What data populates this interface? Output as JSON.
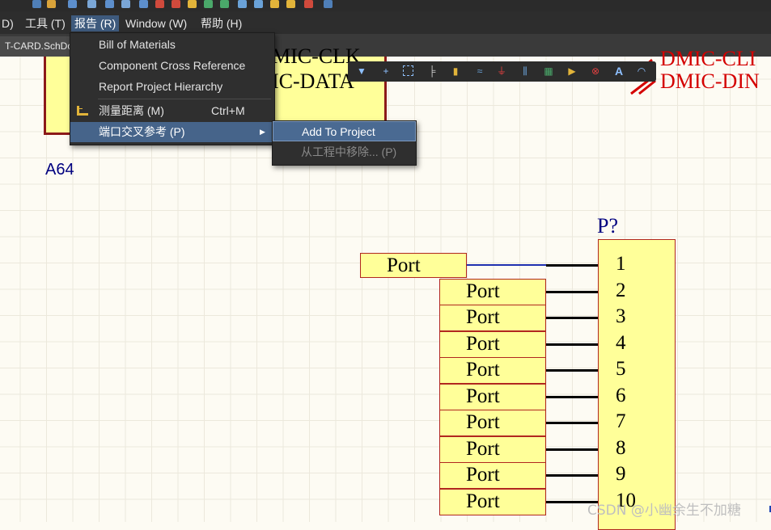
{
  "menubar": {
    "items": [
      {
        "label": "D)"
      },
      {
        "label": "工具 (T)"
      },
      {
        "label": "报告 (R)"
      },
      {
        "label": "Window (W)"
      },
      {
        "label": "帮助 (H)"
      }
    ]
  },
  "tab": {
    "label": "T-CARD.SchDoc"
  },
  "report_menu": {
    "items": [
      {
        "label": "Bill of Materials"
      },
      {
        "label": "Component Cross Reference"
      },
      {
        "label": "Report Project Hierarchy"
      },
      {
        "label": "测量距离 (M)",
        "shortcut": "Ctrl+M"
      },
      {
        "label": "端口交叉参考 (P)"
      }
    ]
  },
  "submenu": {
    "items": [
      {
        "label": "Add To Project",
        "state": "highlighted"
      },
      {
        "label": "从工程中移除... (P)",
        "state": "disabled"
      }
    ]
  },
  "wire_toolbar": {
    "icons": [
      "filter-icon",
      "crosshair-icon",
      "select-rect-icon",
      "align-icon",
      "component-icon",
      "wire-icon",
      "ground-icon",
      "bus-icon",
      "harness-icon",
      "port-icon",
      "no-erc-icon",
      "text-icon",
      "arc-icon"
    ]
  },
  "schematic": {
    "top_labels": [
      "MIC-CLK",
      "IC-DATA"
    ],
    "right_labels": [
      "DMIC-CLI",
      "DMIC-DIN"
    ],
    "designator_left": "A64",
    "component": {
      "designator": "P?",
      "pins": [
        "1",
        "2",
        "3",
        "4",
        "5",
        "6",
        "7",
        "8",
        "9",
        "10"
      ]
    },
    "port_label": "Port"
  },
  "colors": {
    "menu_bg": "#2f2f2f",
    "highlight": "#46648a",
    "port_fill": "#ffff99",
    "port_border": "#b1271f",
    "net_label_red": "#d40000",
    "designator_blue": "#000080"
  },
  "watermark": "CSDN @小幽余生不加糖"
}
